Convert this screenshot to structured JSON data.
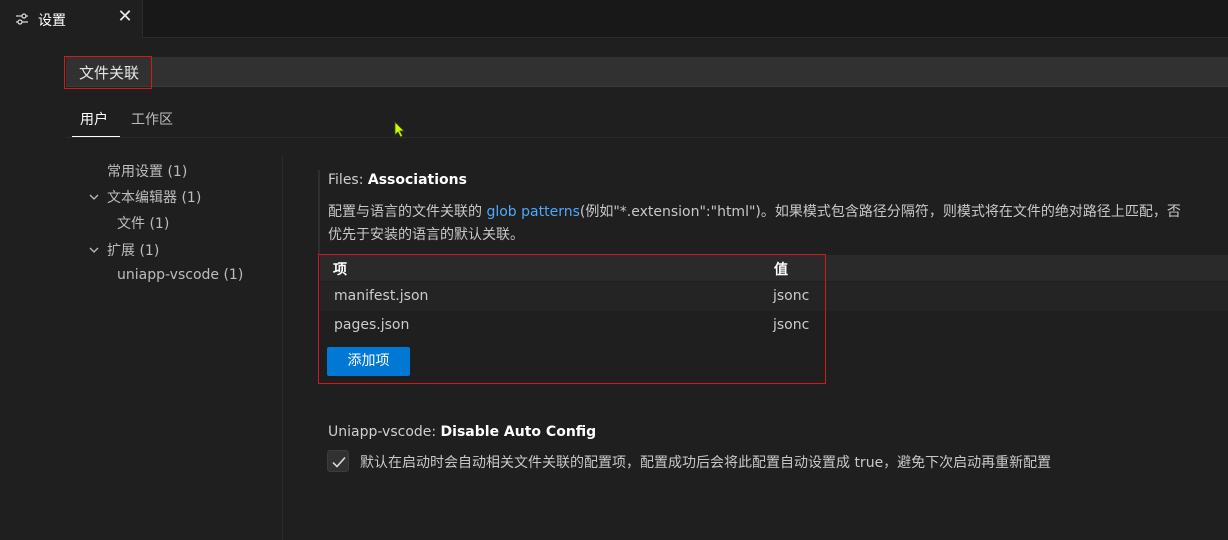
{
  "tab": {
    "icon": "settings-sliders-icon",
    "title": "设置",
    "close_icon": "close-icon",
    "close_glyph": "✕"
  },
  "search": {
    "value": "文件关联"
  },
  "scopes": [
    {
      "label": "用户",
      "active": true
    },
    {
      "label": "工作区",
      "active": false
    }
  ],
  "toc": {
    "items": [
      {
        "label": "常用设置 (1)"
      },
      {
        "label": "文本编辑器 (1)",
        "expanded": true
      },
      {
        "label": "文件 (1)"
      },
      {
        "label": "扩展 (1)",
        "expanded": true
      },
      {
        "label": "uniapp-vscode (1)"
      }
    ]
  },
  "settings": [
    {
      "category": "Files: ",
      "name": "Associations",
      "desc_pre": "配置与语言的文件关联的 ",
      "desc_link": "glob patterns",
      "desc_post": "(例如\"*.extension\":\"html\")。如果模式包含路径分隔符，则模式将在文件的绝对路径上匹配，否",
      "desc_line2": "优先于安装的语言的默认关联。",
      "table": {
        "headers": {
          "item": "项",
          "value": "值"
        },
        "rows": [
          {
            "item": "manifest.json",
            "value": "jsonc"
          },
          {
            "item": "pages.json",
            "value": "jsonc"
          }
        ],
        "add_label": "添加项"
      }
    },
    {
      "category": "Uniapp-vscode: ",
      "name": "Disable Auto Config",
      "checked": true,
      "checkbox_label": "默认在启动时会自动相关文件关联的配置项，配置成功后会将此配置自动设置成 true，避免下次启动再重新配置"
    }
  ],
  "colors": {
    "accent": "#0078d4",
    "link": "#4daafc",
    "annotation": "#d11a1a",
    "cursor": "#c8ff00"
  }
}
